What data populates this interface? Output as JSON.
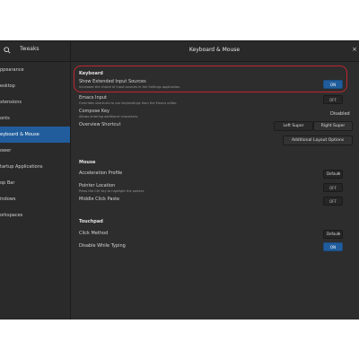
{
  "titlebar": {
    "app_name": "Tweaks",
    "panel_title": "Keyboard & Mouse",
    "close": "×"
  },
  "sidebar": {
    "items": [
      {
        "label": "ppearance",
        "active": false
      },
      {
        "label": "esktop",
        "active": false
      },
      {
        "label": "xtensions",
        "active": false
      },
      {
        "label": "onts",
        "active": false
      },
      {
        "label": "eyboard & Mouse",
        "active": true
      },
      {
        "label": "ower",
        "active": false
      },
      {
        "label": "tartup Applications",
        "active": false
      },
      {
        "label": "op Bar",
        "active": false
      },
      {
        "label": "indows",
        "active": false
      },
      {
        "label": "orkspaces",
        "active": false
      }
    ]
  },
  "keyboard": {
    "title": "Keyboard",
    "show_extended": {
      "label": "Show Extended Input Sources",
      "desc": "Increases the choice of input sources in the Settings application.",
      "state": "ON"
    },
    "emacs": {
      "label": "Emacs Input",
      "desc": "Overrides shortcuts to use keybindings from the Emacs editor.",
      "state": "OFF"
    },
    "compose": {
      "label": "Compose Key",
      "desc": "Allows entering additional characters.",
      "value": "Disabled"
    },
    "overview": {
      "label": "Overview Shortcut",
      "left": "Left Super",
      "right": "Right Super"
    },
    "additional": "Additional Layout Options"
  },
  "mouse": {
    "title": "Mouse",
    "accel": {
      "label": "Acceleration Profile",
      "value": "Default"
    },
    "pointer": {
      "label": "Pointer Location",
      "desc": "Press the Ctrl key to highlight the pointer.",
      "state": "OFF"
    },
    "middle": {
      "label": "Middle Click Paste",
      "state": "OFF"
    }
  },
  "touchpad": {
    "title": "Touchpad",
    "click": {
      "label": "Click Method",
      "value": "Default"
    },
    "disable": {
      "label": "Disable While Typing",
      "state": "ON"
    }
  },
  "colors": {
    "accent": "#215d9c",
    "highlight_border": "#c0262e"
  }
}
